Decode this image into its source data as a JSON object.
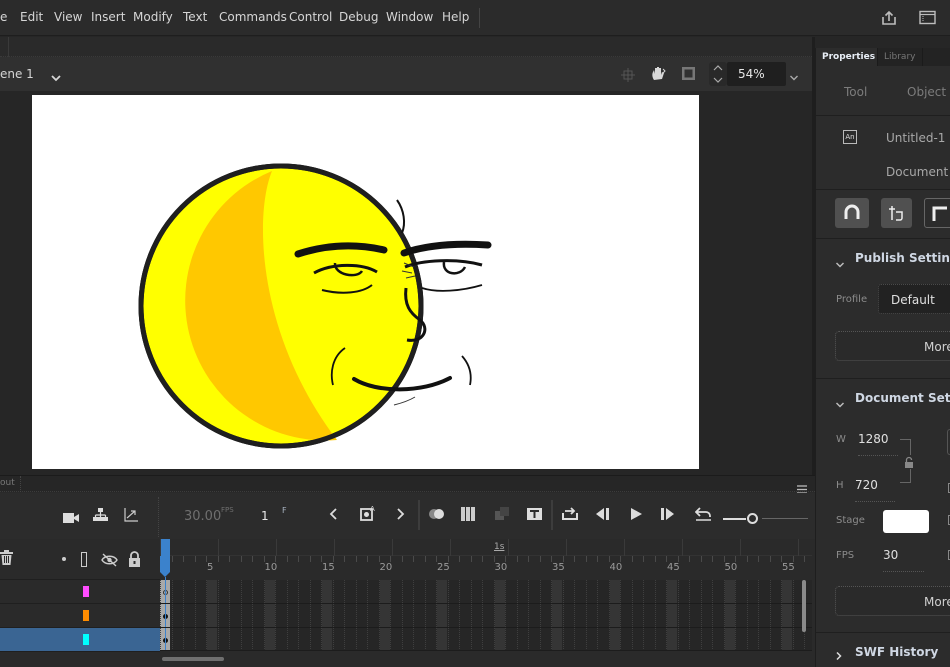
{
  "menubar": {
    "items": [
      "e",
      "Edit",
      "View",
      "Insert",
      "Modify",
      "Text",
      "Commands",
      "Control",
      "Debug",
      "Window",
      "Help"
    ]
  },
  "topright": {
    "share_icon": "share-icon",
    "workspace_icon": "workspace-icon"
  },
  "scene": {
    "label": "ene 1"
  },
  "editbar": {
    "zoom_value": "54%"
  },
  "properties": {
    "tabs": [
      "Properties",
      "Library"
    ],
    "subtabs": [
      "Tool",
      "Object"
    ],
    "doc_name": "Untitled-1",
    "doc_type": "Document",
    "publish": {
      "title": "Publish Settings",
      "profile_label": "Profile",
      "profile_value": "Default",
      "more_label": "More"
    },
    "document": {
      "title": "Document Settir",
      "w_label": "W",
      "w_value": "1280",
      "h_label": "H",
      "h_value": "720",
      "stage_label": "Stage",
      "stage_color": "#ffffff",
      "fps_label": "FPS",
      "fps_value": "30",
      "more_label": "More"
    },
    "swf_history": "SWF History"
  },
  "timeline": {
    "panel_tab": "out",
    "fps": "30.00",
    "fps_unit": "FPS",
    "frame": "1",
    "frame_unit": "F",
    "second_marker": "1s",
    "ruler": [
      "5",
      "10",
      "15",
      "20",
      "25",
      "30",
      "35",
      "40",
      "45",
      "50",
      "55"
    ],
    "layers": [
      {
        "color": "#ff4dff",
        "selected": false
      },
      {
        "color": "#ff8c00",
        "selected": false
      },
      {
        "color": "#00ffff",
        "selected": true
      }
    ],
    "playhead_color": "#3b82cc"
  }
}
